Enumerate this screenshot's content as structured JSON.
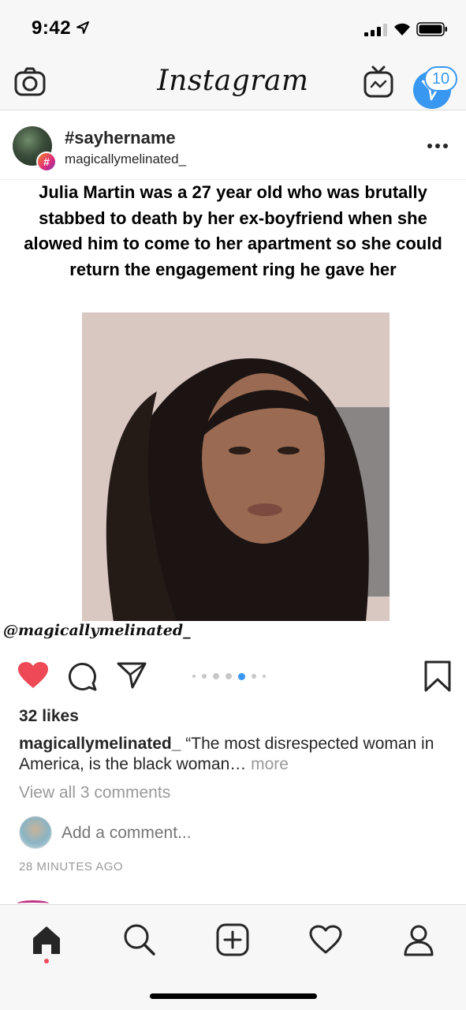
{
  "status_bar": {
    "time": "9:42"
  },
  "header": {
    "logo": "Instagram",
    "dm_badge_count": "10"
  },
  "post": {
    "title": "#sayhername",
    "subtitle": "magicallymelinated_",
    "image_caption": "Julia Martin was a 27 year old who was brutally stabbed to death by her ex-boyfriend when she alowed him to come to her apartment so she could return the engagement ring he gave her",
    "watermark": "@magicallymelinated_",
    "carousel": {
      "total": 7,
      "active_index": 4
    },
    "likes": "32 likes",
    "caption_user": "magicallymelinated_",
    "caption_text": " “The most disrespected woman in America, is the black woman… ",
    "caption_more": "more",
    "view_comments": "View all 3 comments",
    "add_comment_placeholder": "Add a comment...",
    "timestamp": "28 MINUTES AGO"
  },
  "colors": {
    "like_red": "#ed4956",
    "accent_blue": "#3897f0",
    "muted_gray": "#999999"
  },
  "tab_bar": {
    "items": [
      "home-icon",
      "search-icon",
      "add-post-icon",
      "activity-heart-icon",
      "profile-icon"
    ],
    "active": "home-icon"
  }
}
